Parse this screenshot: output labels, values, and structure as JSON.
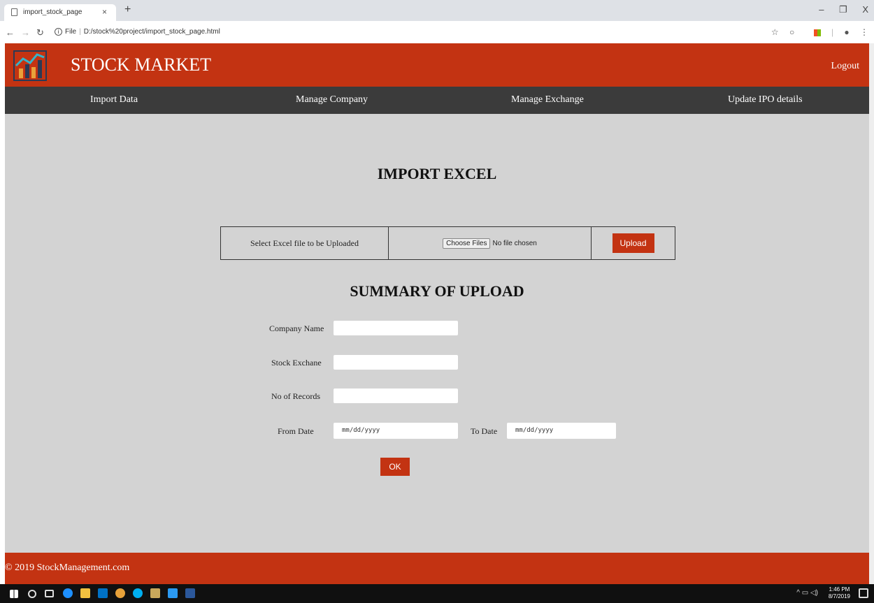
{
  "browser": {
    "tab_title": "import_stock_page",
    "tab_close": "×",
    "new_tab": "+",
    "minimize": "–",
    "restore": "❐",
    "close": "X",
    "url_prefix": "File",
    "url": "D:/stock%20project/import_stock_page.html"
  },
  "header": {
    "title": "STOCK MARKET",
    "logout": "Logout"
  },
  "menu": {
    "items": [
      "Import Data",
      "Manage Company",
      "Manage Exchange",
      "Update IPO details"
    ]
  },
  "import": {
    "heading": "IMPORT EXCEL",
    "select_label": "Select Excel file to be Uploaded",
    "choose_files": "Choose Files",
    "no_file": "No file chosen",
    "upload": "Upload"
  },
  "summary": {
    "heading": "SUMMARY OF UPLOAD",
    "company_label": "Company Name",
    "company_value": "",
    "exchange_label": "Stock Exchane",
    "exchange_value": "",
    "records_label": "No of Records",
    "records_value": "",
    "from_label": "From Date",
    "from_placeholder": "mm/dd/yyyy",
    "to_label": "To Date",
    "to_placeholder": "mm/dd/yyyy",
    "ok": "OK"
  },
  "footer": {
    "text": "© 2019 StockManagement.com"
  },
  "taskbar": {
    "time": "1:46 PM",
    "date": "8/7/2019"
  },
  "colors": {
    "brand_red": "#c33312",
    "menu_dark": "#3b3b3b",
    "page_gray": "#d3d3d3"
  }
}
